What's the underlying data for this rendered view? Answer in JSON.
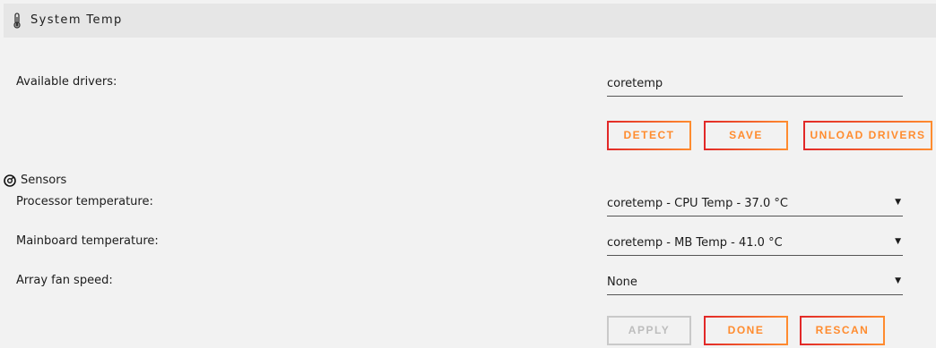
{
  "header": {
    "title": "System Temp",
    "icon": "thermometer-icon"
  },
  "drivers": {
    "label": "Available drivers:",
    "value": "coretemp"
  },
  "driver_buttons": {
    "detect": "DETECT",
    "save": "SAVE",
    "unload": "UNLOAD DRIVERS"
  },
  "sensors": {
    "heading": "Sensors",
    "icon": "gauge-icon",
    "rows": [
      {
        "label": "Processor temperature:",
        "value": "coretemp - CPU Temp - 37.0 °C"
      },
      {
        "label": "Mainboard temperature:",
        "value": "coretemp - MB Temp - 41.0 °C"
      },
      {
        "label": "Array fan speed:",
        "value": "None"
      }
    ]
  },
  "bottom_buttons": {
    "apply": "APPLY",
    "done": "DONE",
    "rescan": "RESCAN"
  },
  "colors": {
    "accent_start": "#e22828",
    "accent_end": "#ff8c2f",
    "disabled": "#c9c9c9",
    "background": "#f2f2f2",
    "titlebar": "#e6e6e6"
  }
}
